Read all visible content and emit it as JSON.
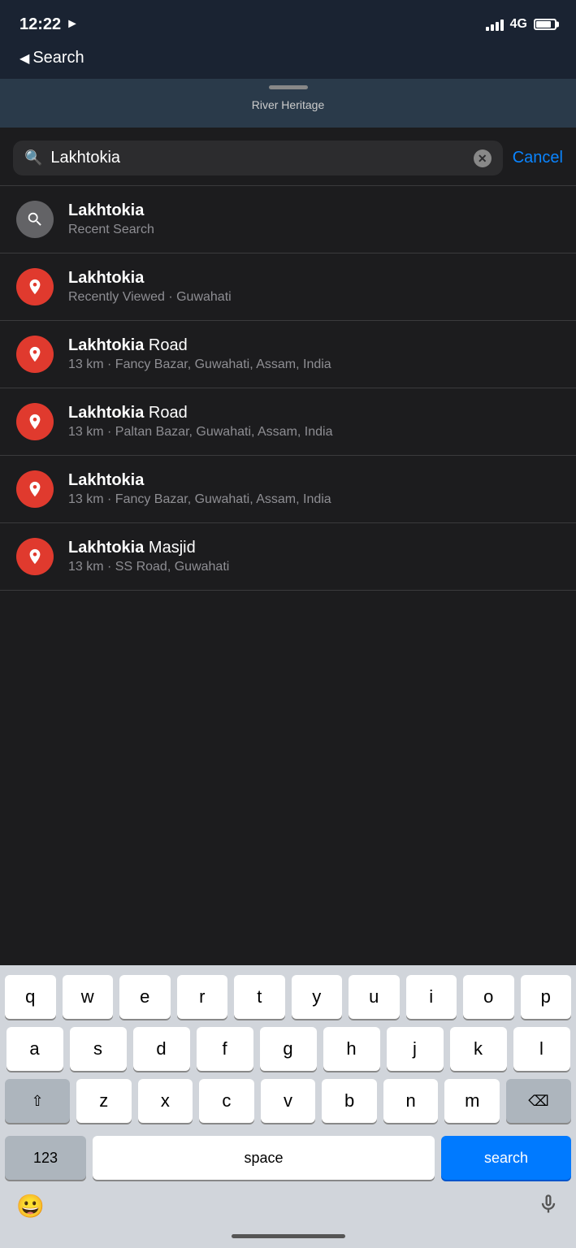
{
  "statusBar": {
    "time": "12:22",
    "network": "4G"
  },
  "nav": {
    "back_label": "Search"
  },
  "map": {
    "label": "River Heritage"
  },
  "searchBar": {
    "query": "Lakhtokia",
    "cancel_label": "Cancel"
  },
  "results": [
    {
      "id": "recent",
      "icon_type": "grey",
      "title_bold": "Lakhtokia",
      "title_rest": "",
      "subtitle": "Recent Search"
    },
    {
      "id": "viewed",
      "icon_type": "red",
      "title_bold": "Lakhtokia",
      "title_rest": "",
      "subtitle": "Recently Viewed · Guwahati"
    },
    {
      "id": "road1",
      "icon_type": "red",
      "title_bold": "Lakhtokia",
      "title_rest": " Road",
      "subtitle": "13 km · Fancy Bazar, Guwahati, Assam, India"
    },
    {
      "id": "road2",
      "icon_type": "red",
      "title_bold": "Lakhtokia",
      "title_rest": " Road",
      "subtitle": "13 km · Paltan Bazar, Guwahati, Assam, India"
    },
    {
      "id": "place",
      "icon_type": "red",
      "title_bold": "Lakhtokia",
      "title_rest": "",
      "subtitle": "13 km · Fancy Bazar, Guwahati, Assam, India"
    },
    {
      "id": "masjid",
      "icon_type": "red",
      "title_bold": "Lakhtokia",
      "title_rest": " Masjid",
      "subtitle": "13 km · SS Road, Guwahati"
    }
  ],
  "keyboard": {
    "rows": [
      [
        "q",
        "w",
        "e",
        "r",
        "t",
        "y",
        "u",
        "i",
        "o",
        "p"
      ],
      [
        "a",
        "s",
        "d",
        "f",
        "g",
        "h",
        "j",
        "k",
        "l"
      ],
      [
        "z",
        "x",
        "c",
        "v",
        "b",
        "n",
        "m"
      ]
    ],
    "num_label": "123",
    "space_label": "space",
    "search_label": "search"
  }
}
